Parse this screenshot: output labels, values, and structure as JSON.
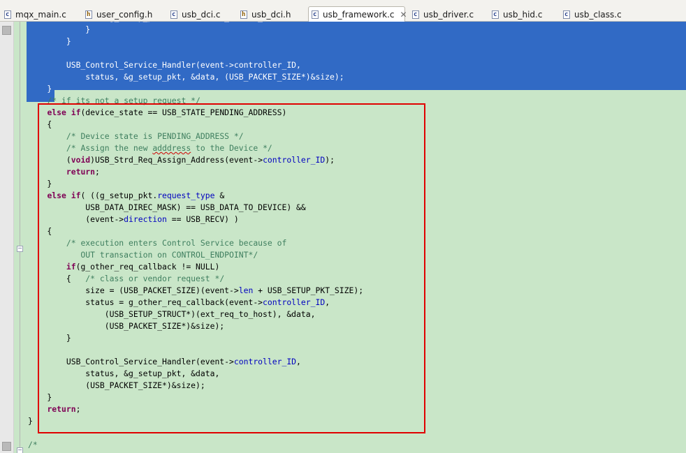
{
  "tabs": [
    {
      "label": "mqx_main.c",
      "kind": "c",
      "active": false
    },
    {
      "label": "user_config.h",
      "kind": "h",
      "active": false
    },
    {
      "label": "usb_dci.c",
      "kind": "c",
      "active": false
    },
    {
      "label": "usb_dci.h",
      "kind": "h",
      "active": false
    },
    {
      "label": "usb_framework.c",
      "kind": "c",
      "active": true
    },
    {
      "label": "usb_driver.c",
      "kind": "c",
      "active": false
    },
    {
      "label": "usb_hid.c",
      "kind": "c",
      "active": false
    },
    {
      "label": "usb_class.c",
      "kind": "c",
      "active": false
    }
  ],
  "icons": {
    "c_glyph": "c",
    "h_glyph": "h",
    "close": "✕"
  },
  "colors": {
    "selection": "#316ac5",
    "editor_bg": "#c9e6c8",
    "keyword": "#7f0055",
    "comment": "#3f7f5f",
    "field": "#0000c0",
    "highlight_box": "#e00000"
  },
  "code": {
    "selected_lines": [
      [
        {
          "t": "                &g_setup_pkt, &data, (USB_PACKET_SIZE*)&size);"
        }
      ],
      [
        {
          "t": "            }"
        }
      ],
      [
        {
          "t": "        }"
        }
      ],
      [
        {
          "t": ""
        }
      ],
      [
        {
          "t": "        USB_Control_Service_Handler(event->controller_ID,"
        }
      ],
      [
        {
          "t": "            status, &g_setup_pkt, &data, (USB_PACKET_SIZE*)&size);"
        }
      ],
      [
        {
          "t": "    }"
        }
      ]
    ],
    "lines": [
      [
        {
          "t": "    "
        },
        {
          "t": "/* if its not a setup request */",
          "c": "cm"
        }
      ],
      [
        {
          "t": "    "
        },
        {
          "t": "else if",
          "c": "kw"
        },
        {
          "t": "(device_state == USB_STATE_PENDING_ADDRESS)"
        }
      ],
      [
        {
          "t": "    {"
        }
      ],
      [
        {
          "t": "        "
        },
        {
          "t": "/* Device state is PENDING_ADDRESS */",
          "c": "cm"
        }
      ],
      [
        {
          "t": "        "
        },
        {
          "t": "/* Assign the new ",
          "c": "cm"
        },
        {
          "t": "adddress",
          "c": "cm misspell"
        },
        {
          "t": " to the Device */",
          "c": "cm"
        }
      ],
      [
        {
          "t": "        ("
        },
        {
          "t": "void",
          "c": "kw"
        },
        {
          "t": ")USB_Strd_Req_Assign_Address(event->"
        },
        {
          "t": "controller_ID",
          "c": "fld"
        },
        {
          "t": ");"
        }
      ],
      [
        {
          "t": "        "
        },
        {
          "t": "return",
          "c": "kw"
        },
        {
          "t": ";"
        }
      ],
      [
        {
          "t": "    }"
        }
      ],
      [
        {
          "t": "    "
        },
        {
          "t": "else if",
          "c": "kw"
        },
        {
          "t": "( ((g_setup_pkt."
        },
        {
          "t": "request_type",
          "c": "fld"
        },
        {
          "t": " &"
        }
      ],
      [
        {
          "t": "            USB_DATA_DIREC_MASK) == USB_DATA_TO_DEVICE) &&"
        }
      ],
      [
        {
          "t": "            (event->"
        },
        {
          "t": "direction",
          "c": "fld"
        },
        {
          "t": " == USB_RECV) )"
        }
      ],
      [
        {
          "t": "    {"
        }
      ],
      [
        {
          "t": "        "
        },
        {
          "t": "/* execution enters Control Service because of",
          "c": "cm"
        }
      ],
      [
        {
          "t": "           OUT transaction on CONTROL_ENDPOINT*/",
          "c": "cm"
        }
      ],
      [
        {
          "t": "        "
        },
        {
          "t": "if",
          "c": "kw"
        },
        {
          "t": "(g_other_req_callback != NULL)"
        }
      ],
      [
        {
          "t": "        {   "
        },
        {
          "t": "/* class or vendor request */",
          "c": "cm"
        }
      ],
      [
        {
          "t": "            size = (USB_PACKET_SIZE)(event->"
        },
        {
          "t": "len",
          "c": "fld"
        },
        {
          "t": " + USB_SETUP_PKT_SIZE);"
        }
      ],
      [
        {
          "t": "            status = g_other_req_callback(event->"
        },
        {
          "t": "controller_ID",
          "c": "fld"
        },
        {
          "t": ","
        }
      ],
      [
        {
          "t": "                (USB_SETUP_STRUCT*)(ext_req_to_host), &data,"
        }
      ],
      [
        {
          "t": "                (USB_PACKET_SIZE*)&size);"
        }
      ],
      [
        {
          "t": "        }"
        }
      ],
      [
        {
          "t": ""
        }
      ],
      [
        {
          "t": "        USB_Control_Service_Handler(event->"
        },
        {
          "t": "controller_ID",
          "c": "fld"
        },
        {
          "t": ","
        }
      ],
      [
        {
          "t": "            status, &g_setup_pkt, &data,"
        }
      ],
      [
        {
          "t": "            (USB_PACKET_SIZE*)&size);"
        }
      ],
      [
        {
          "t": "    }"
        }
      ],
      [
        {
          "t": "    "
        },
        {
          "t": "return",
          "c": "kw"
        },
        {
          "t": ";"
        }
      ],
      [
        {
          "t": "}"
        }
      ],
      [
        {
          "t": ""
        }
      ],
      [
        {
          "t": "/*",
          "c": "cm"
        }
      ]
    ]
  }
}
